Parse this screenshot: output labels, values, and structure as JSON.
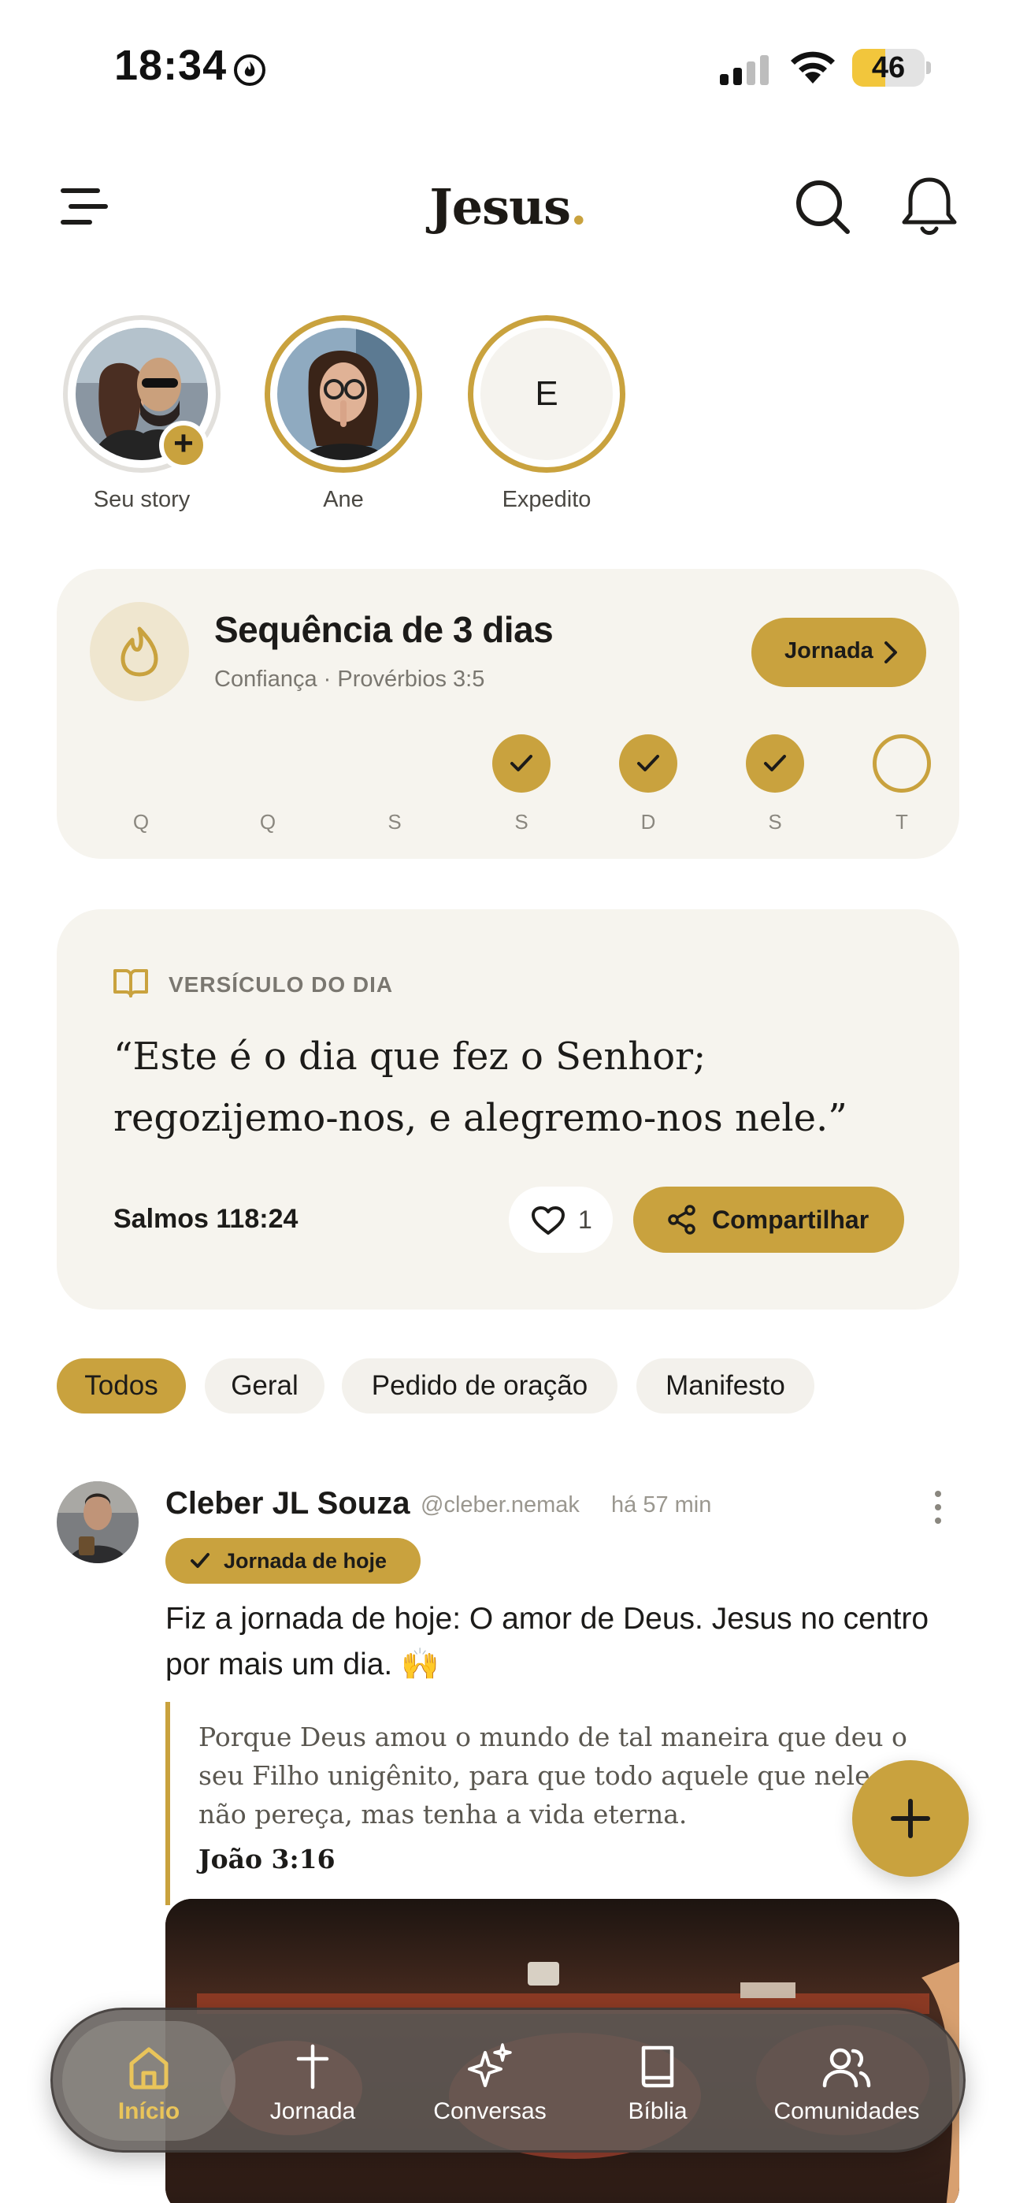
{
  "status_bar": {
    "time": "18:34",
    "battery_level": "46",
    "battery_fraction": 0.46
  },
  "header": {
    "title": "Jesus",
    "title_dot": "."
  },
  "stories": [
    {
      "name": "Seu story",
      "type": "own"
    },
    {
      "name": "Ane",
      "type": "new"
    },
    {
      "name": "Expedito",
      "type": "new",
      "initial": "E"
    }
  ],
  "streak": {
    "title": "Sequência de 3 dias",
    "subtitle": "Confiança · Provérbios 3:5",
    "button_label": "Jornada",
    "days": [
      {
        "letter": "Q",
        "state": "none"
      },
      {
        "letter": "Q",
        "state": "none"
      },
      {
        "letter": "S",
        "state": "none"
      },
      {
        "letter": "S",
        "state": "done"
      },
      {
        "letter": "D",
        "state": "done"
      },
      {
        "letter": "S",
        "state": "done"
      },
      {
        "letter": "T",
        "state": "todo"
      }
    ]
  },
  "verse": {
    "label": "VERSÍCULO DO DIA",
    "text": "“Este é o dia que fez o Senhor; regozijemo-nos, e alegremo-nos nele.”",
    "reference": "Salmos 118:24",
    "likes": "1",
    "share_label": "Compartilhar"
  },
  "filters": [
    {
      "label": "Todos",
      "active": true
    },
    {
      "label": "Geral",
      "active": false
    },
    {
      "label": "Pedido de oração",
      "active": false
    },
    {
      "label": "Manifesto",
      "active": false
    }
  ],
  "post": {
    "author": "Cleber JL Souza",
    "handle": "@cleber.nemak",
    "time": "há 57 min",
    "badge": "Jornada de hoje",
    "text": "Fiz a jornada de hoje: O amor de Deus. Jesus no centro por mais um dia. 🙌",
    "quote": "Porque Deus amou o mundo de tal maneira que deu o seu Filho unigênito, para que todo aquele que nele crê não pereça, mas tenha a vida eterna.",
    "quote_ref": "João 3:16"
  },
  "tabs": [
    {
      "label": "Início",
      "icon": "home-icon",
      "active": true
    },
    {
      "label": "Jornada",
      "icon": "cross-icon",
      "active": false
    },
    {
      "label": "Conversas",
      "icon": "sparkles-icon",
      "active": false
    },
    {
      "label": "Bíblia",
      "icon": "book-icon",
      "active": false
    },
    {
      "label": "Comunidades",
      "icon": "users-icon",
      "active": false
    }
  ],
  "colors": {
    "accent": "#c9a23e",
    "card_bg": "#f6f4ee",
    "chip_bg": "#f3f1ec",
    "text": "#1c1b19",
    "muted": "#7a7770",
    "tabbar_bg": "#605a56"
  }
}
